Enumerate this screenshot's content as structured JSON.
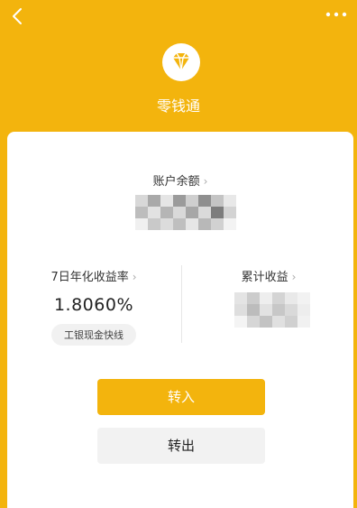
{
  "title": "零钱通",
  "balance_label": "账户余额",
  "stats": {
    "rate_label": "7日年化收益率",
    "rate_value": "1.8060%",
    "rate_tag": "工银现金快线",
    "income_label": "累计收益"
  },
  "buttons": {
    "transfer_in": "转入",
    "transfer_out": "转出"
  },
  "colors": {
    "brand": "#f3b40d",
    "card": "#ffffff"
  },
  "icons": {
    "back": "chevron-left-icon",
    "more": "more-dots-icon",
    "logo": "diamond-icon"
  }
}
